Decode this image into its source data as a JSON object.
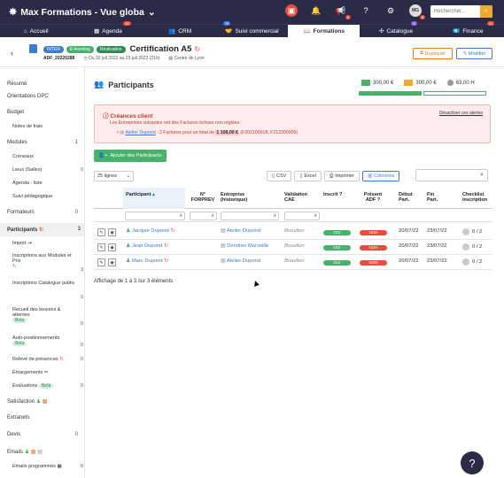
{
  "app": {
    "title": "Max Formations - Vue globa",
    "search_placeholder": "Rechercher..."
  },
  "topbar_badges": {
    "notifications": "8",
    "avatar": "MG",
    "avatar_badge": "9"
  },
  "nav": {
    "tabs": [
      {
        "label": "Accueil",
        "badge": ""
      },
      {
        "label": "Agenda",
        "badge": "20"
      },
      {
        "label": "CRM",
        "badge": ""
      },
      {
        "label": "Suivi commercial",
        "badge": "75"
      },
      {
        "label": "Formations",
        "badge": ""
      },
      {
        "label": "Catalogue",
        "badge": "8"
      },
      {
        "label": "Finance",
        "badge": "20"
      }
    ]
  },
  "header": {
    "tags": [
      "INTER",
      "E-learning",
      "Réalisation"
    ],
    "title": "Certification A5",
    "ref": "ADF_20220288",
    "dates": "Du 20 juil 2022 au 23 juil 2022 (21h)",
    "location": "Centre de Lyon",
    "duplicate": "Dupliquer",
    "modify": "Modifier"
  },
  "sidebar": {
    "items": [
      {
        "label": "Résumé",
        "count": ""
      },
      {
        "label": "Orientations DPC",
        "count": ""
      },
      {
        "label": "Budget",
        "count": ""
      },
      {
        "label": "Notes de frais",
        "count": ""
      },
      {
        "label": "Modules",
        "count": "1"
      },
      {
        "label": "Créneaux",
        "count": ""
      },
      {
        "label": "Lieux (Salles)",
        "count": "0"
      },
      {
        "label": "Agenda - liste",
        "count": ""
      },
      {
        "label": "Suivi pédagogique",
        "count": ""
      },
      {
        "label": "Formateurs",
        "count": "0"
      },
      {
        "label": "Participants",
        "count": "3"
      },
      {
        "label": "Import",
        "count": ""
      },
      {
        "label": "Inscriptions aux Modules et Prix",
        "count": "3"
      },
      {
        "label": "Inscriptions Catalogue public",
        "count": "0"
      },
      {
        "label": "Recueil des besoins & attentes",
        "count": "0"
      },
      {
        "label": "Auto-positionnements",
        "count": "0"
      },
      {
        "label": "Relevé de présences",
        "count": "0"
      },
      {
        "label": "Émargements",
        "count": ""
      },
      {
        "label": "Évaluations",
        "count": "0"
      },
      {
        "label": "Satisfaction",
        "count": ""
      },
      {
        "label": "Extranets",
        "count": ""
      },
      {
        "label": "Devis",
        "count": "0"
      },
      {
        "label": "Emails",
        "count": ""
      },
      {
        "label": "Emails programmés",
        "count": "0"
      }
    ],
    "beta": "Beta"
  },
  "main": {
    "title": "Participants",
    "stats": {
      "amount1": "300,00 €",
      "amount2": "300,00 €",
      "hours": "63,00 H",
      "progress1": 1.0,
      "progress2": 0.0
    },
    "alert": {
      "title": "Créances client",
      "link": "Désactiver ces alertes",
      "desc": "Les Entreprises suivantes ont des Factures échues non réglées :",
      "company": "Atelier Dupond",
      "text_before": " : 2 Factures pour un total de ",
      "amount": "1 108,00 €",
      "text_after": " (F202100018, F212200006)"
    },
    "add_button": "Ajouter des Participants",
    "page_size": "25 lignes",
    "buttons": {
      "csv": "CSV",
      "excel": "Excel",
      "print": "Imprimer",
      "columns": "Colonnes"
    },
    "columns": [
      "Participant",
      "N° FORPREV",
      "Entreprise (historique)",
      "Validation CAE",
      "Inscrit ?",
      "Présent ADF ?",
      "Début Part.",
      "Fin Part.",
      "Checklist inscription"
    ],
    "rows": [
      {
        "name": "Jacquie Dupond",
        "company": "Atelier Dupond",
        "cae": "Brouillon",
        "inscrit": "OUI",
        "present": "NON",
        "start": "20/07/22",
        "end": "23/07/22",
        "check": "0 / 2"
      },
      {
        "name": "Jean Dupond",
        "company": "Dendreo Marseille",
        "cae": "Brouillon",
        "inscrit": "OUI",
        "present": "NON",
        "start": "20/07/22",
        "end": "23/07/22",
        "check": "0 / 2"
      },
      {
        "name": "Marc Dupond",
        "company": "Atelier Dupond",
        "cae": "Brouillon",
        "inscrit": "OUI",
        "present": "NON",
        "start": "20/07/22",
        "end": "23/07/22",
        "check": "0 / 2"
      }
    ],
    "footer": "Affichage de 1 à 3 sur 3 éléments"
  },
  "help": "?"
}
